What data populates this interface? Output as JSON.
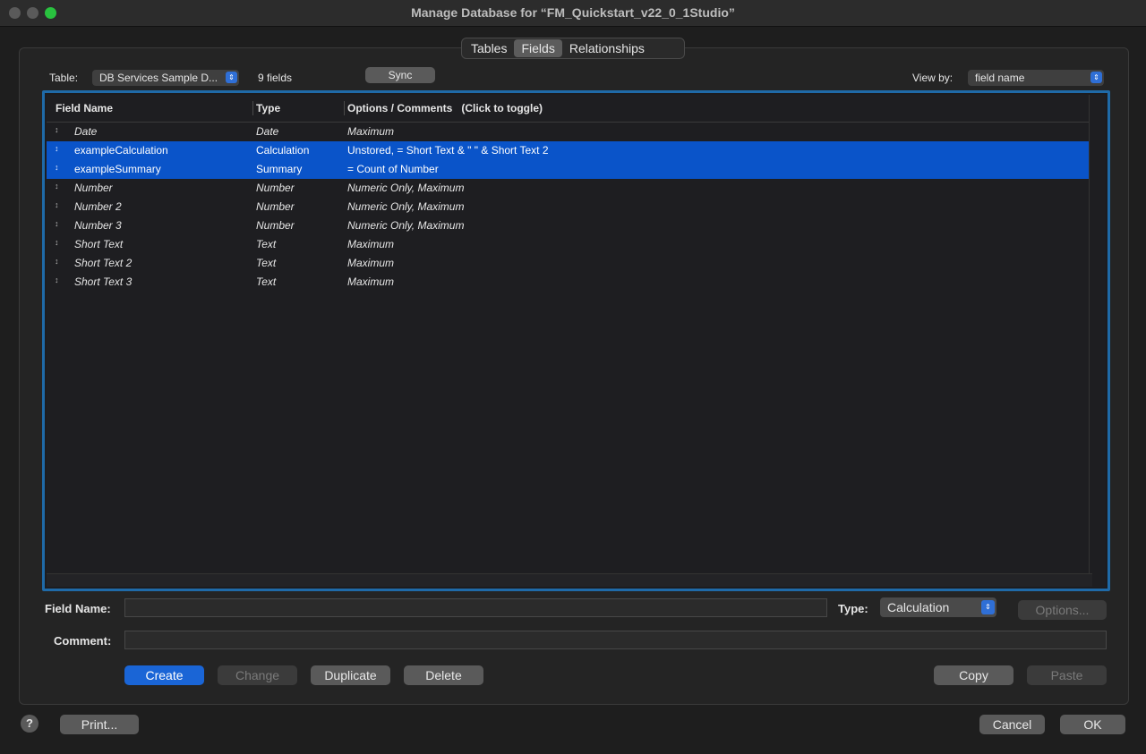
{
  "window": {
    "title": "Manage Database for “FM_Quickstart_v22_0_1Studio”"
  },
  "tabs": [
    {
      "label": "Tables",
      "active": false
    },
    {
      "label": "Fields",
      "active": true
    },
    {
      "label": "Relationships",
      "active": false
    }
  ],
  "toolbar": {
    "table_label": "Table:",
    "table_value": "DB Services Sample D...",
    "field_count": "9 fields",
    "sync_label": "Sync",
    "view_by_label": "View by:",
    "view_by_value": "field name"
  },
  "table": {
    "columns": [
      "Field Name",
      "Type",
      "Options / Comments   (Click to toggle)"
    ],
    "rows": [
      {
        "name": "Date",
        "type": "Date",
        "options": "Maximum",
        "selected": false
      },
      {
        "name": "exampleCalculation",
        "type": "Calculation",
        "options": "Unstored, = Short Text & \" \" & Short Text 2",
        "selected": true
      },
      {
        "name": "exampleSummary",
        "type": "Summary",
        "options": "= Count of Number",
        "selected": true
      },
      {
        "name": "Number",
        "type": "Number",
        "options": "Numeric Only, Maximum",
        "selected": false
      },
      {
        "name": "Number 2",
        "type": "Number",
        "options": "Numeric Only, Maximum",
        "selected": false
      },
      {
        "name": "Number 3",
        "type": "Number",
        "options": "Numeric Only, Maximum",
        "selected": false
      },
      {
        "name": "Short Text",
        "type": "Text",
        "options": "Maximum",
        "selected": false
      },
      {
        "name": "Short Text 2",
        "type": "Text",
        "options": "Maximum",
        "selected": false
      },
      {
        "name": "Short Text 3",
        "type": "Text",
        "options": "Maximum",
        "selected": false
      }
    ]
  },
  "form": {
    "field_name_label": "Field Name:",
    "field_name_value": "",
    "type_label": "Type:",
    "type_value": "Calculation",
    "options_label": "Options...",
    "comment_label": "Comment:",
    "comment_value": ""
  },
  "actions": {
    "create": "Create",
    "change": "Change",
    "duplicate": "Duplicate",
    "delete": "Delete",
    "copy": "Copy",
    "paste": "Paste"
  },
  "footer": {
    "help": "?",
    "print": "Print...",
    "cancel": "Cancel",
    "ok": "OK"
  },
  "colors": {
    "selection": "#0a54c9",
    "focus_ring": "#1f6aa8",
    "primary_button": "#1a65d6",
    "zoom_button": "#29c23f"
  }
}
